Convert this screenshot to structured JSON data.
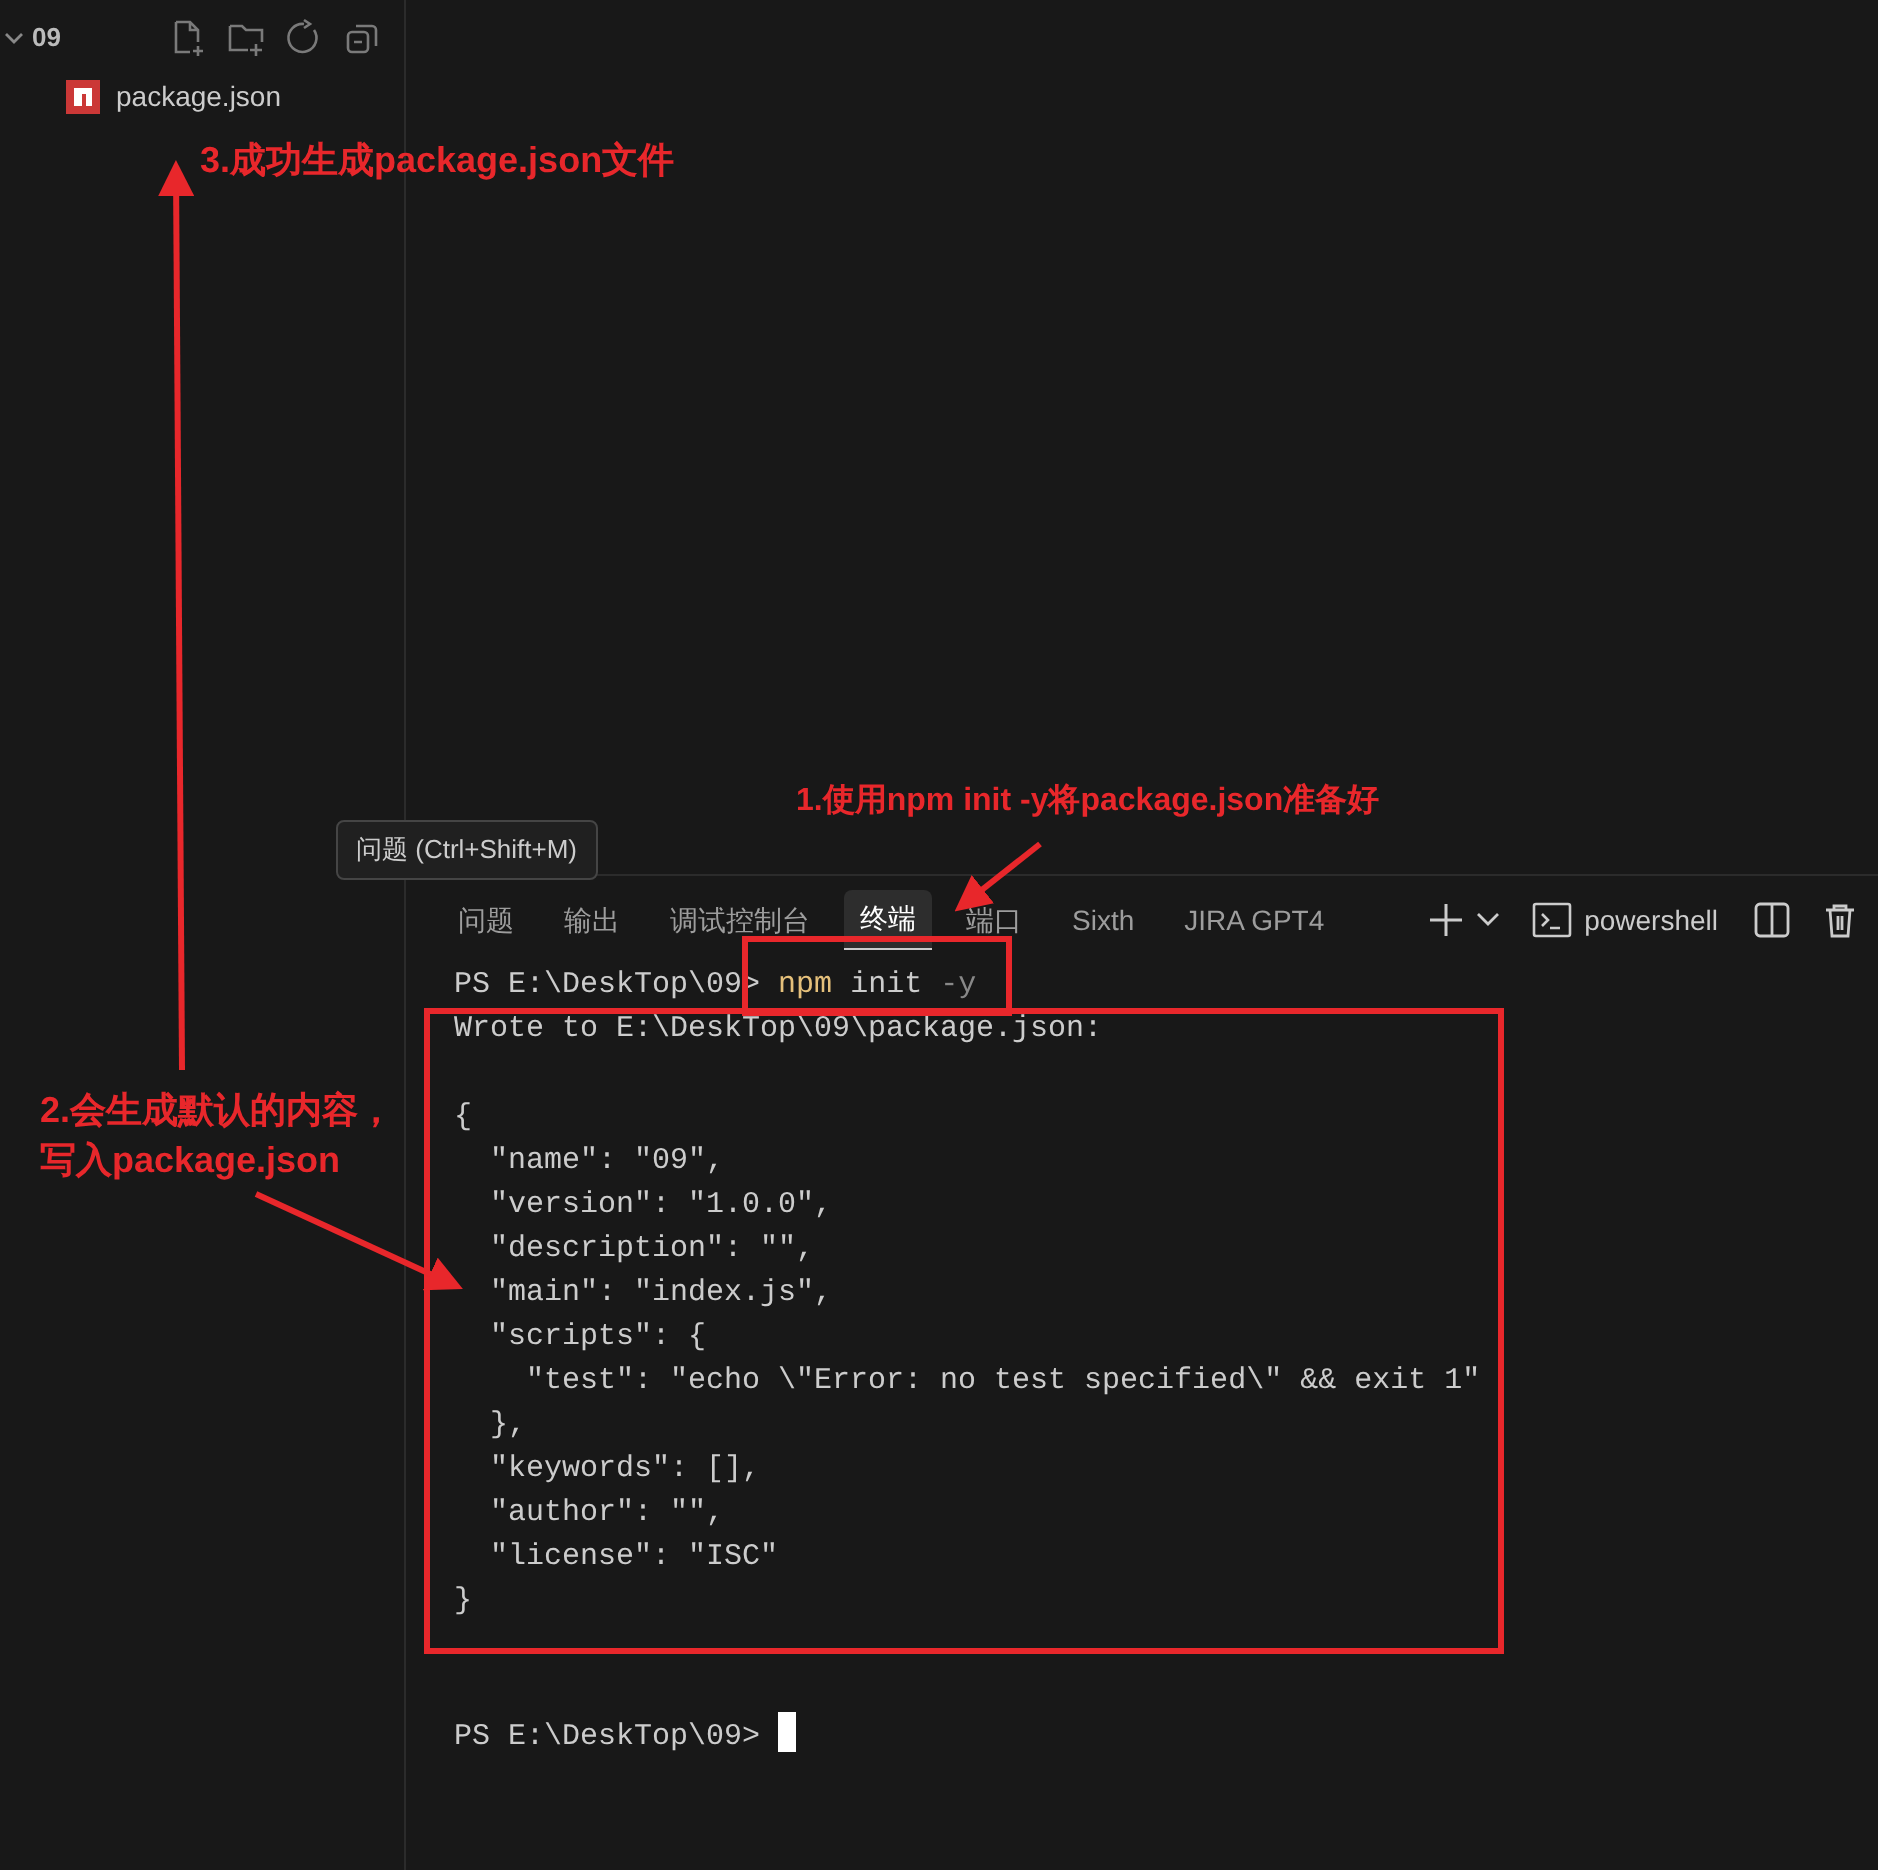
{
  "explorer": {
    "folder": "09",
    "expanded": true,
    "files": [
      {
        "name": "package.json"
      }
    ]
  },
  "tooltip": "问题 (Ctrl+Shift+M)",
  "panel_tabs": [
    {
      "label": "问题",
      "selected": false
    },
    {
      "label": "输出",
      "selected": false
    },
    {
      "label": "调试控制台",
      "selected": false
    },
    {
      "label": "终端",
      "selected": true
    },
    {
      "label": "端口",
      "selected": false
    },
    {
      "label": "Sixth",
      "selected": false
    },
    {
      "label": "JIRA GPT4",
      "selected": false
    }
  ],
  "terminal_profile": "powershell",
  "terminal": {
    "prompt": "PS E:\\DeskTop\\09>",
    "command": [
      "npm",
      "init",
      "-y"
    ],
    "message": "Wrote to E:\\DeskTop\\09\\package.json:",
    "json_lines": [
      "{",
      "  \"name\": \"09\",",
      "  \"version\": \"1.0.0\",",
      "  \"description\": \"\",",
      "  \"main\": \"index.js\",",
      "  \"scripts\": {",
      "    \"test\": \"echo \\\"Error: no test specified\\\" && exit 1\"",
      "  },",
      "  \"keywords\": [],",
      "  \"author\": \"\",",
      "  \"license\": \"ISC\"",
      "}"
    ],
    "final_prompt": "PS E:\\DeskTop\\09>"
  },
  "annotations": [
    {
      "text": "3.成功生成package.json文件"
    },
    {
      "text": "1.使用npm init -y将package.json准备好"
    },
    {
      "text": "2.会生成默认的内容，写入package.json"
    }
  ]
}
